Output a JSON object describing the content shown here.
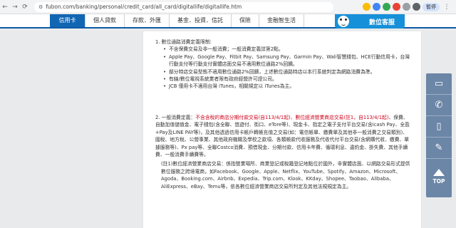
{
  "browser": {
    "url": "fubon.com/banking/personal/credit_card/all_card/digitallife/digitallife.htm",
    "profile_label": "暫停"
  },
  "nav": {
    "items": [
      "信用卡",
      "個人貸款",
      "存款．外匯",
      "基金．投資．信託",
      "保險",
      "金融智生活"
    ],
    "service_label": "數位客服"
  },
  "section1": {
    "title": "1. 數位通路消費定義限制:",
    "bullets": [
      "不含保費交易及非一般消費；一般消費定義詳第2點。",
      "Apple Pay、Google Pay、Fitbit Pay、Samsung Pay、Garmin Pay、Wali智慧錢包、HCE行動信用卡，台灣行動支付等行動支付實體店面交易不適用數位通路2%回饋。",
      "部分特店交易型態不適用數位通路2%回饋，上述數位通路特店以本行系統判定為網路消費為準。",
      "有線/數位電視系統業者限有政府經營許可證公司。",
      "JCB 僅用卡不適用台灣 iTunes，相關規定以 iTunes為主。"
    ]
  },
  "section2": {
    "title_prefix": "2. 一般消費定義：",
    "title_red": "不含含稅的商店分期付款交易(自113/4/1起)、數位經濟營業商店交易(註1，自113/4/1起)",
    "body": "、保費、自動加值儲值金、電子錢包(含全聯、悠遊付、街口、eTore等)、現金卡、指定之電子支付平台交易(含icash Pay、全盈+Pay及LINE PAY等)，及其他透過信用卡帳戶轉帳充值之交易(如：電信帳單、繳費單及其他非一般消費之交易類別)、國稅、地方稅、公營事業、其他政府機關及學校之款項、各類帳款代收服務及代收代付平台交易(含網購代收、繳費、單據服務等)、Px pay等、全聯Costco消費、預借現金、分期付款、信用卡年費、循環利息、違約金、掛失費、其他手續費、一般消費手續費等。",
    "note": "(註1)數位經濟營業商店交易：係指營業場所、商業登記或稅籍登記地點位於國外，非實體店面、以網路交易形式提供數位服務之跨境電商，如Facebook、Google、Apple、Netflix、YouTube、Spotify、Amazon、Microsoft、Agoda、Booking.com、Airbnb、Expedia、Trip.com、Klook、KKday、Shopee、Taobao、Alibaba、AliExpress、eBay、Temu等，依各數位經濟營業商店交易所判定及其他法規規定為主。"
  },
  "sidebar": {
    "top_label": "TOP"
  }
}
